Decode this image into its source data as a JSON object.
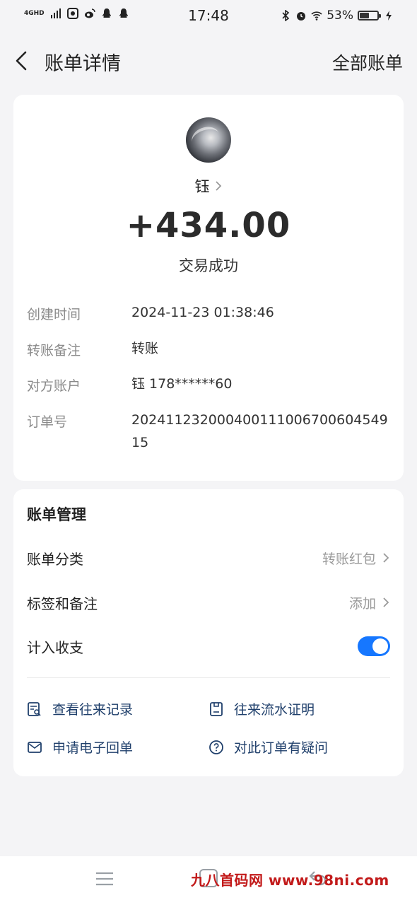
{
  "status_bar": {
    "network": "4GHD",
    "time": "17:48",
    "battery_text": "53%",
    "battery_level": 0.53
  },
  "nav": {
    "title": "账单详情",
    "right_link": "全部账单"
  },
  "transaction": {
    "payee": "钰",
    "amount": "+434.00",
    "status": "交易成功",
    "details": [
      {
        "label": "创建时间",
        "value": "2024-11-23 01:38:46"
      },
      {
        "label": "转账备注",
        "value": "转账"
      },
      {
        "label": "对方账户",
        "value": "钰 178******60"
      },
      {
        "label": "订单号",
        "value": "20241123200040011100670060454915"
      }
    ]
  },
  "management": {
    "title": "账单管理",
    "category_label": "账单分类",
    "category_value": "转账红包",
    "tags_label": "标签和备注",
    "tags_value": "添加",
    "count_label": "计入收支",
    "count_enabled": true,
    "links": [
      {
        "label": "查看往来记录",
        "icon": "records-search-icon"
      },
      {
        "label": "往来流水证明",
        "icon": "statement-document-icon"
      },
      {
        "label": "申请电子回单",
        "icon": "envelope-icon"
      },
      {
        "label": "对此订单有疑问",
        "icon": "question-circle-icon"
      }
    ]
  },
  "watermark": "九八首码网 www.98ni.com",
  "colors": {
    "accent": "#1677ff",
    "link": "#1f3f6b",
    "watermark": "#c21a1a"
  }
}
